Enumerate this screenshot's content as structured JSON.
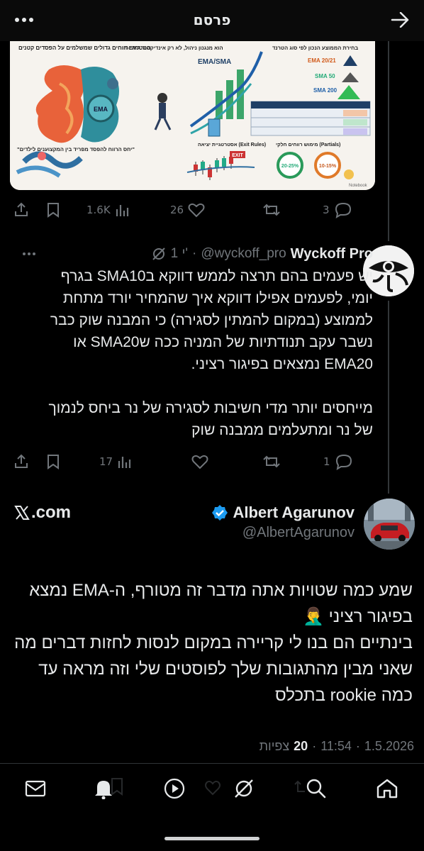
{
  "header": {
    "title": "פרסם"
  },
  "post_image": {
    "headline_left": "המטרה: רווחים גדולים שמשלמים על הפסדים קטנים",
    "headline_mid": "ה-EMA הוא מנגנון ניהול, לא רק אינדיקטור",
    "headline_right": "בחירת הממוצע הנכון לפי סוג הטרנד",
    "ema_label": "EMA/SMA",
    "ema20": "EMA 20/21",
    "sma50": "SMA 50",
    "sma200": "SMA 200",
    "exit_rules": "אסטרטגיית יציאה (Exit Rules)",
    "partials": "מימוש רווחים חלקי (Partials)",
    "pct_a": "20-25%",
    "pct_b": "10-15%",
    "quote": "\"יחס הרווח להפסד מפריד בין המקצוענים לילדים\"",
    "brain_label": "EMA",
    "exit_tag": "EXIT",
    "watermark": "Notebook"
  },
  "post_actions": {
    "views": "1.6K",
    "likes": "26",
    "replies": "3"
  },
  "reply": {
    "author_name": "Wyckoff Pro",
    "author_handle": "@wyckoff_pro",
    "time": "1 י'",
    "text": "יש פעמים בהם תרצה לממש דווקא בSMA10 בגרף יומי, לפעמים אפילו דווקא איך שהמחיר יורד מתחת לממוצע (במקום להמתין לסגירה) כי המבנה שוק כבר נשבר עקב תנודתיות של המניה ככה שSMA20 או EMA20 נמצאים בפיגור רציני.\n\nמייחסים יותר מדי חשיבות לסגירה של נר ביחס לנמוך של נר ומתעלמים ממבנה שוק",
    "views": "17",
    "replies": "1"
  },
  "main": {
    "author_name": "Albert Agarunov",
    "author_handle": "@AlbertAgarunov",
    "source": ".com",
    "text": "שמע כמה שטויות אתה מדבר זה מטורף, ה-EMA נמצא בפיגור רציני 🤦‍♂️\nבינתיים הם בנו לי קריירה במקום לנסות לחזות דברים מה שאני מבין מהתגובות שלך לפוסטים שלי וזה מראה עד כמה rookie בתכלס",
    "date": "1.5.2026",
    "time": "11:54",
    "views_count": "20",
    "views_label": "צפיות",
    "dot": "·"
  },
  "colors": {
    "background": "#000000",
    "text": "#e7e9ea",
    "muted": "#71767b",
    "verified": "#1d9bf0"
  }
}
